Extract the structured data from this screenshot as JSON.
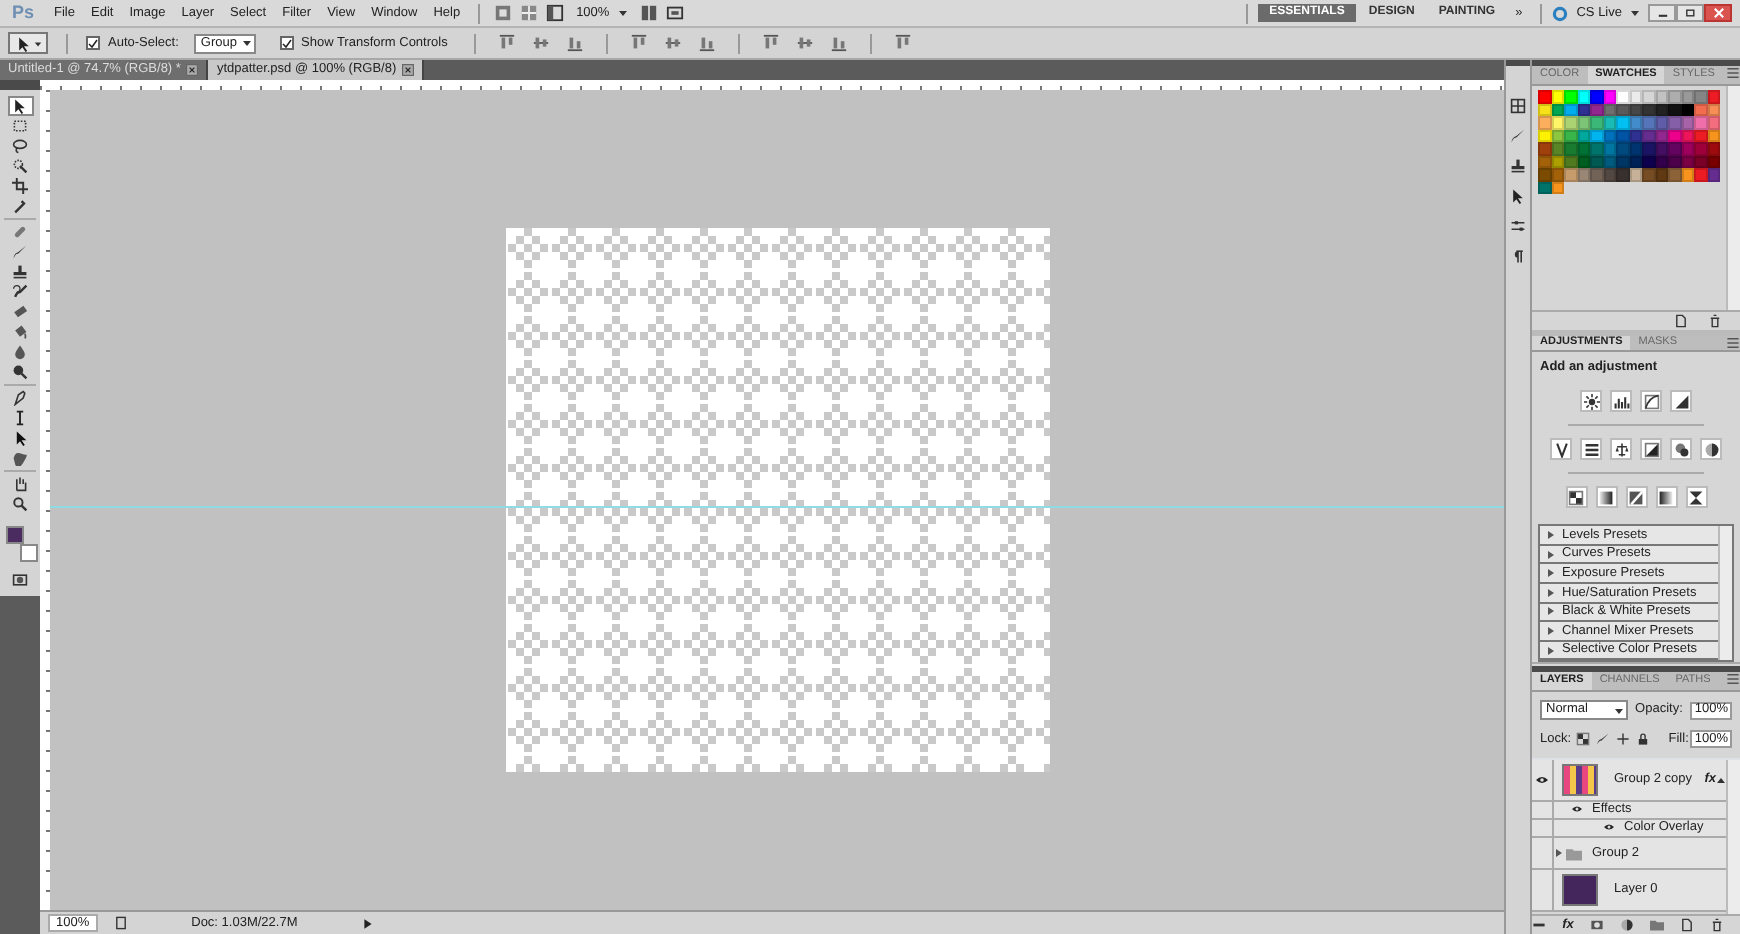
{
  "app": {
    "logo": "Ps",
    "menus": [
      "File",
      "Edit",
      "Image",
      "Layer",
      "Select",
      "Filter",
      "View",
      "Window",
      "Help"
    ],
    "zoom": "100%",
    "workspaces": [
      {
        "label": "ESSENTIALS",
        "selected": true
      },
      {
        "label": "DESIGN",
        "selected": false
      },
      {
        "label": "PAINTING",
        "selected": false
      }
    ],
    "more": "»",
    "cs_live": "CS Live"
  },
  "options_bar": {
    "auto_select": {
      "label": "Auto-Select:",
      "checked": true
    },
    "auto_select_target": "Group",
    "transform_controls": {
      "label": "Show Transform Controls",
      "checked": true
    }
  },
  "document_tabs": [
    {
      "title": "Untitled-1 @ 74.7% (RGB/8) *",
      "selected": false
    },
    {
      "title": "ytdpatter.psd @ 100% (RGB/8)",
      "selected": true
    }
  ],
  "tools": [
    {
      "selected": true
    },
    {
      "selected": false
    },
    {
      "selected": false
    },
    {
      "selected": false
    },
    {
      "selected": false
    },
    {
      "selected": false
    },
    {
      "selected": false
    },
    {
      "selected": false
    },
    {
      "selected": false
    },
    {
      "selected": false
    },
    {
      "selected": false
    },
    {
      "selected": false
    },
    {
      "selected": false
    },
    {
      "selected": false
    },
    {
      "selected": false
    },
    {
      "selected": false
    },
    {
      "selected": false
    },
    {
      "selected": false
    },
    {
      "selected": false
    },
    {
      "selected": false
    }
  ],
  "color_chips": [
    {
      "kind": "background",
      "color": "#ffffff"
    },
    {
      "kind": "foreground",
      "color": "#4a2c60"
    }
  ],
  "status_bar": {
    "zoom": "100%",
    "doc_size": "Doc: 1.03M/22.7M"
  },
  "swatches_panel": {
    "tabs": [
      {
        "label": "COLOR",
        "selected": false
      },
      {
        "label": "SWATCHES",
        "selected": true
      },
      {
        "label": "STYLES",
        "selected": false
      }
    ],
    "swatches": [
      {
        "color": "#ff0000"
      },
      {
        "color": "#ffff00"
      },
      {
        "color": "#00ff00"
      },
      {
        "color": "#00ffff"
      },
      {
        "color": "#0000ff"
      },
      {
        "color": "#ff00ff"
      },
      {
        "color": "#ffffff"
      },
      {
        "color": "#ebebeb"
      },
      {
        "color": "#d6d6d6"
      },
      {
        "color": "#c2c2c2"
      },
      {
        "color": "#adadad"
      },
      {
        "color": "#999999"
      },
      {
        "color": "#858585"
      },
      {
        "color": "#ed1c24"
      },
      {
        "color": "#f7e11a"
      },
      {
        "color": "#00a651"
      },
      {
        "color": "#00aeef"
      },
      {
        "color": "#2e3192"
      },
      {
        "color": "#92278f"
      },
      {
        "color": "#706f6f"
      },
      {
        "color": "#5a5a5a"
      },
      {
        "color": "#464646"
      },
      {
        "color": "#333333"
      },
      {
        "color": "#222222"
      },
      {
        "color": "#111111"
      },
      {
        "color": "#000000"
      },
      {
        "color": "#f26c4f"
      },
      {
        "color": "#f68e55"
      },
      {
        "color": "#fbaf5d"
      },
      {
        "color": "#fff568"
      },
      {
        "color": "#acd372"
      },
      {
        "color": "#7cc576"
      },
      {
        "color": "#3bb878"
      },
      {
        "color": "#1abbb4"
      },
      {
        "color": "#00bff3"
      },
      {
        "color": "#438ccb"
      },
      {
        "color": "#5574b9"
      },
      {
        "color": "#605ca8"
      },
      {
        "color": "#855fa8"
      },
      {
        "color": "#a763a8"
      },
      {
        "color": "#f06ea9"
      },
      {
        "color": "#f26d7d"
      },
      {
        "color": "#fff200"
      },
      {
        "color": "#8dc63f"
      },
      {
        "color": "#39b54a"
      },
      {
        "color": "#00a99d"
      },
      {
        "color": "#00b4ef"
      },
      {
        "color": "#0072bc"
      },
      {
        "color": "#0054a6"
      },
      {
        "color": "#2e3192"
      },
      {
        "color": "#662d91"
      },
      {
        "color": "#92278f"
      },
      {
        "color": "#ec008c"
      },
      {
        "color": "#ed145b"
      },
      {
        "color": "#ed1c24"
      },
      {
        "color": "#f7941d"
      },
      {
        "color": "#a0410d"
      },
      {
        "color": "#598527"
      },
      {
        "color": "#197b30"
      },
      {
        "color": "#007236"
      },
      {
        "color": "#00746b"
      },
      {
        "color": "#0076a3"
      },
      {
        "color": "#004a80"
      },
      {
        "color": "#003471"
      },
      {
        "color": "#1b1464"
      },
      {
        "color": "#440e62"
      },
      {
        "color": "#630460"
      },
      {
        "color": "#9e005d"
      },
      {
        "color": "#9e0039"
      },
      {
        "color": "#9e0b0f"
      },
      {
        "color": "#a36209"
      },
      {
        "color": "#aba000"
      },
      {
        "color": "#4f7a20"
      },
      {
        "color": "#005e20"
      },
      {
        "color": "#005952"
      },
      {
        "color": "#005b7f"
      },
      {
        "color": "#003663"
      },
      {
        "color": "#002157"
      },
      {
        "color": "#0d004c"
      },
      {
        "color": "#32004b"
      },
      {
        "color": "#4b0049"
      },
      {
        "color": "#7b0046"
      },
      {
        "color": "#7a0026"
      },
      {
        "color": "#790000"
      },
      {
        "color": "#7a4b00"
      },
      {
        "color": "#a36209"
      },
      {
        "color": "#c69c6d"
      },
      {
        "color": "#998675"
      },
      {
        "color": "#736357"
      },
      {
        "color": "#534741"
      },
      {
        "color": "#37302d"
      },
      {
        "color": "#c7b299"
      },
      {
        "color": "#754c24"
      },
      {
        "color": "#603913"
      },
      {
        "color": "#8c6239"
      },
      {
        "color": "#f7941d"
      },
      {
        "color": "#ed1c24"
      },
      {
        "color": "#662d91"
      },
      {
        "color": "#00746b"
      },
      {
        "color": "#f7941d"
      }
    ]
  },
  "adjustments_panel": {
    "tabs": [
      {
        "label": "ADJUSTMENTS",
        "selected": true
      },
      {
        "label": "MASKS",
        "selected": false
      }
    ],
    "heading": "Add an adjustment",
    "presets": [
      "Levels Presets",
      "Curves Presets",
      "Exposure Presets",
      "Hue/Saturation Presets",
      "Black & White Presets",
      "Channel Mixer Presets",
      "Selective Color Presets"
    ]
  },
  "layers_panel": {
    "tabs": [
      {
        "label": "LAYERS",
        "selected": true
      },
      {
        "label": "CHANNELS",
        "selected": false
      },
      {
        "label": "PATHS",
        "selected": false
      }
    ],
    "blend_mode": "Normal",
    "opacity_label": "Opacity:",
    "opacity": "100%",
    "lock_label": "Lock:",
    "fill_label": "Fill:",
    "fill": "100%",
    "layers": [
      {
        "name": "Group 2 copy",
        "kind": "smart",
        "visible": true,
        "fx": "fx",
        "effects": [
          {
            "name": "Effects",
            "visible": true,
            "children": [
              {
                "name": "Color Overlay",
                "visible": true
              }
            ]
          }
        ]
      },
      {
        "name": "Group 2",
        "kind": "group",
        "visible": false
      },
      {
        "name": "Layer 0",
        "kind": "fill",
        "visible": false
      }
    ],
    "footer_fx": "fx"
  }
}
